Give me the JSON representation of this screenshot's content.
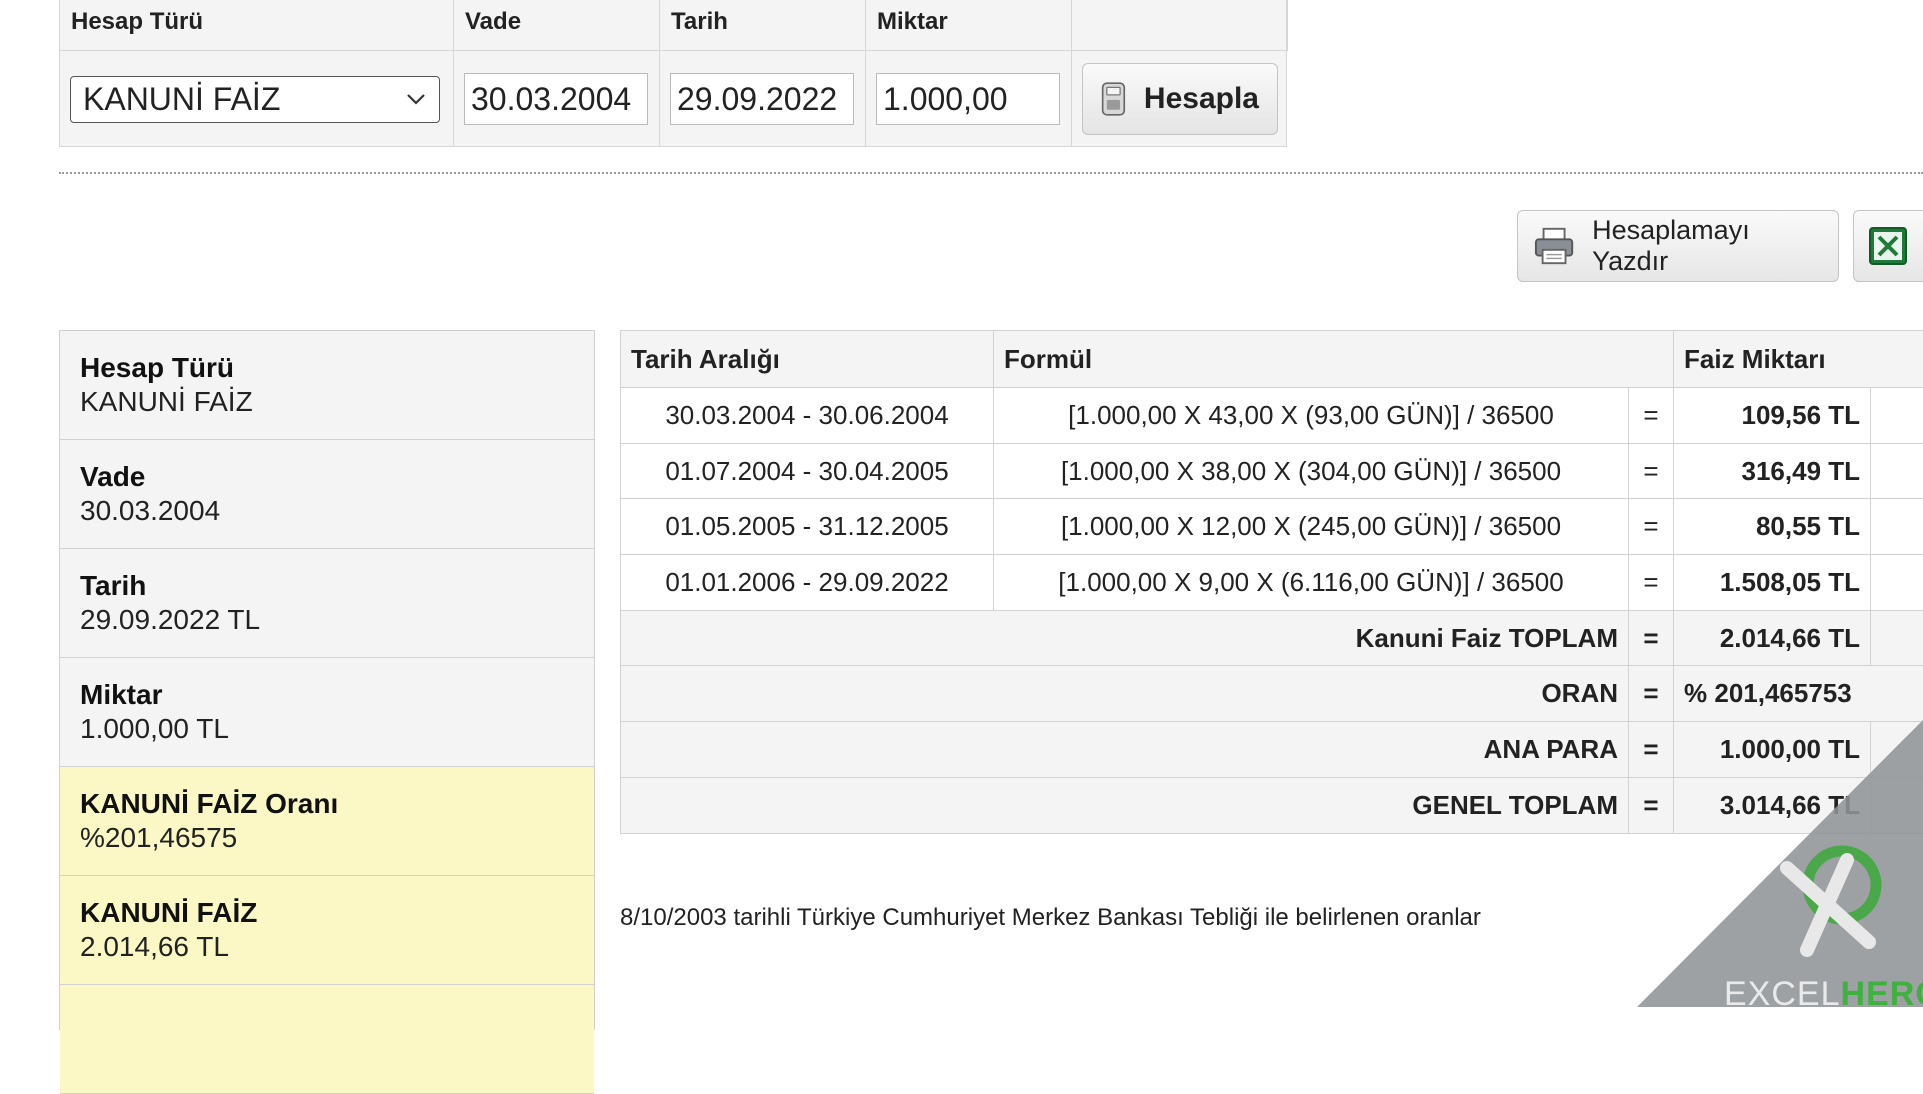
{
  "form": {
    "headers": [
      "Hesap Türü",
      "Vade",
      "Tarih",
      "Miktar",
      ""
    ],
    "hesap_turu": "KANUNİ FAİZ",
    "vade": "30.03.2004",
    "tarih": "29.09.2022",
    "miktar": "1.000,00",
    "hesapla_label": "Hesapla"
  },
  "actions": {
    "print_label": "Hesaplamayı Yazdır"
  },
  "summary": [
    {
      "label": "Hesap Türü",
      "value": "KANUNİ FAİZ"
    },
    {
      "label": "Vade",
      "value": "30.03.2004"
    },
    {
      "label": "Tarih",
      "value": "29.09.2022 TL"
    },
    {
      "label": "Miktar",
      "value": "1.000,00 TL"
    },
    {
      "label": "KANUNİ FAİZ Oranı",
      "value": "%201,46575"
    },
    {
      "label": "KANUNİ FAİZ",
      "value": "2.014,66 TL"
    }
  ],
  "results": {
    "headers": {
      "range": "Tarih Aralığı",
      "formula": "Formül",
      "amount": "Faiz Miktarı"
    },
    "rows": [
      {
        "range": "30.03.2004 - 30.06.2004",
        "formula": "[1.000,00 X 43,00 X (93,00 GÜN)] / 36500",
        "eq": "=",
        "amount": "109,56 TL"
      },
      {
        "range": "01.07.2004 - 30.04.2005",
        "formula": "[1.000,00 X 38,00 X (304,00 GÜN)] / 36500",
        "eq": "=",
        "amount": "316,49 TL"
      },
      {
        "range": "01.05.2005 - 31.12.2005",
        "formula": "[1.000,00 X 12,00 X (245,00 GÜN)] / 36500",
        "eq": "=",
        "amount": "80,55 TL"
      },
      {
        "range": "01.01.2006 - 29.09.2022",
        "formula": "[1.000,00 X 9,00 X (6.116,00 GÜN)] / 36500",
        "eq": "=",
        "amount": "1.508,05 TL"
      }
    ],
    "totals": [
      {
        "label": "Kanuni Faiz TOPLAM",
        "eq": "=",
        "amount": "2.014,66 TL"
      },
      {
        "label": "ORAN",
        "eq": "=",
        "amount": "% 201,465753"
      },
      {
        "label": "ANA PARA",
        "eq": "=",
        "amount": "1.000,00 TL"
      },
      {
        "label": "GENEL TOPLAM",
        "eq": "=",
        "amount": "3.014,66 TL"
      }
    ]
  },
  "note": "8/10/2003 tarihli Türkiye Cumhuriyet Merkez Bankası Tebliği ile belirlenen oranlar",
  "watermark": {
    "excel": "EXCEL",
    "hero": "HERO"
  },
  "colors": {
    "highlight": "#fbf8c5",
    "panel": "#f4f4f4",
    "border": "#d2d2d2",
    "hero_green": "#3fb13f"
  },
  "icons": {
    "calc": "calculator-icon",
    "print": "printer-icon",
    "excel": "excel-icon",
    "select": "chevron-down-icon"
  }
}
